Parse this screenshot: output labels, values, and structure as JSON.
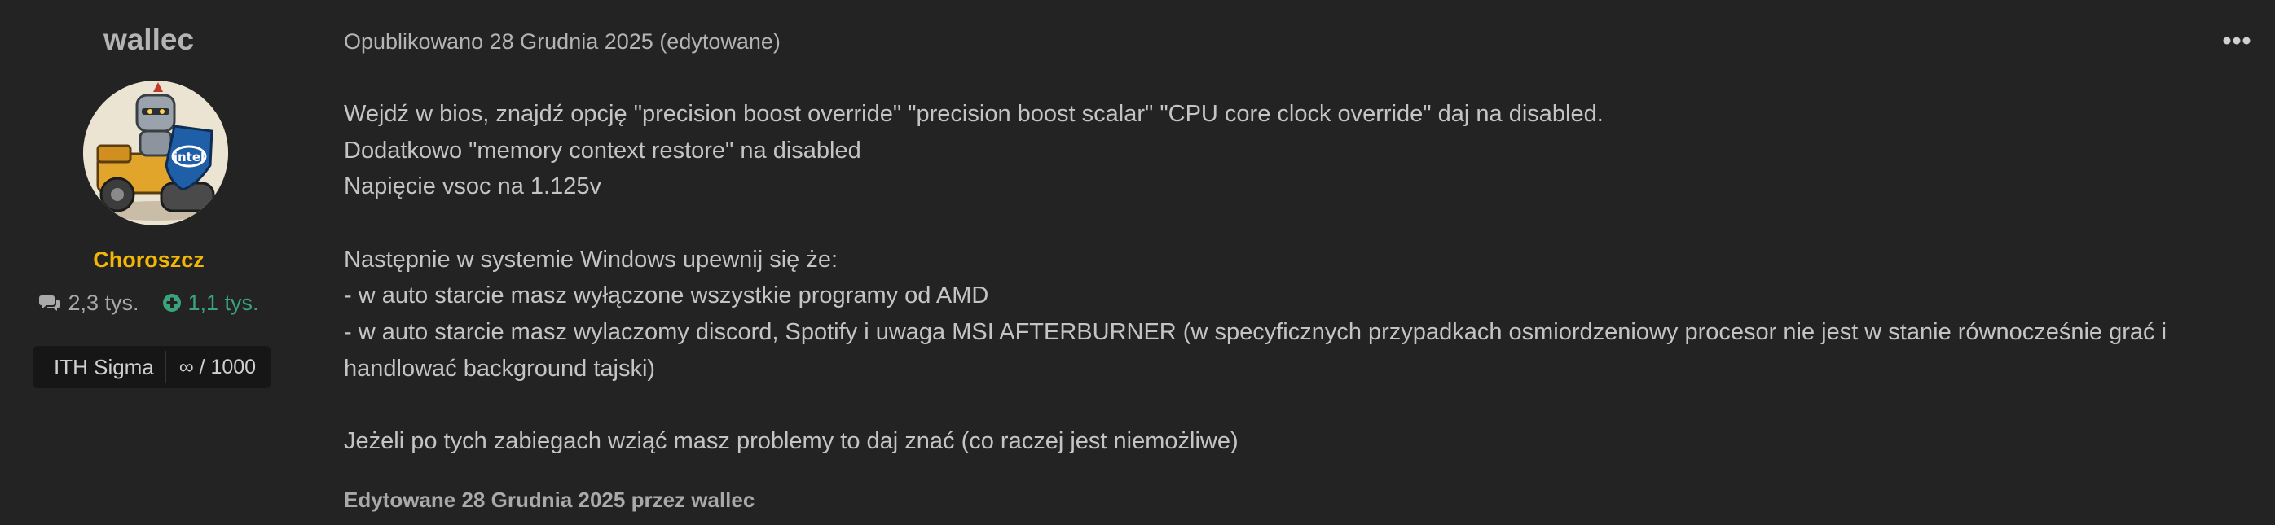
{
  "author": {
    "username": "wallec",
    "group": "Choroszcz",
    "stats": {
      "posts": "2,3 tys.",
      "reputation": "1,1 tys."
    },
    "rank": {
      "title": "ITH Sigma",
      "points": "∞ / 1000"
    },
    "avatar_icon": "knight-robot-mascot-icon",
    "avatar_badge_text": "intel"
  },
  "post": {
    "published_label": "Opublikowano",
    "published_date": "28 Grudnia 2025",
    "edited_flag": "(edytowane)",
    "more_icon": "ellipsis-icon",
    "lines": [
      "Wejdź w bios, znajdź opcję \"precision boost override\" \"precision boost scalar\" \"CPU core clock override\" daj na disabled.",
      "Dodatkowo \"memory context restore\" na disabled",
      "Napięcie vsoc na 1.125v",
      "",
      "Następnie w systemie Windows upewnij się że:",
      "- w auto starcie masz wyłączone wszystkie programy od AMD",
      "- w auto starcie masz wylaczomy discord, Spotify i uwaga MSI AFTERBURNER (w specyficznych przypadkach osmiordzeniowy procesor nie jest w stanie równocześnie grać i",
      "handlować background tajski)",
      "",
      "Jeżeli po tych zabiegach wziąć masz problemy to daj znać (co raczej jest niemożliwe)"
    ],
    "edited_note": "Edytowane 28 Grudnia 2025 przez wallec"
  },
  "colors": {
    "background": "#232323",
    "group_color": "#f2b705",
    "reputation_color": "#3aa37b",
    "text": "#c4c4c4"
  }
}
